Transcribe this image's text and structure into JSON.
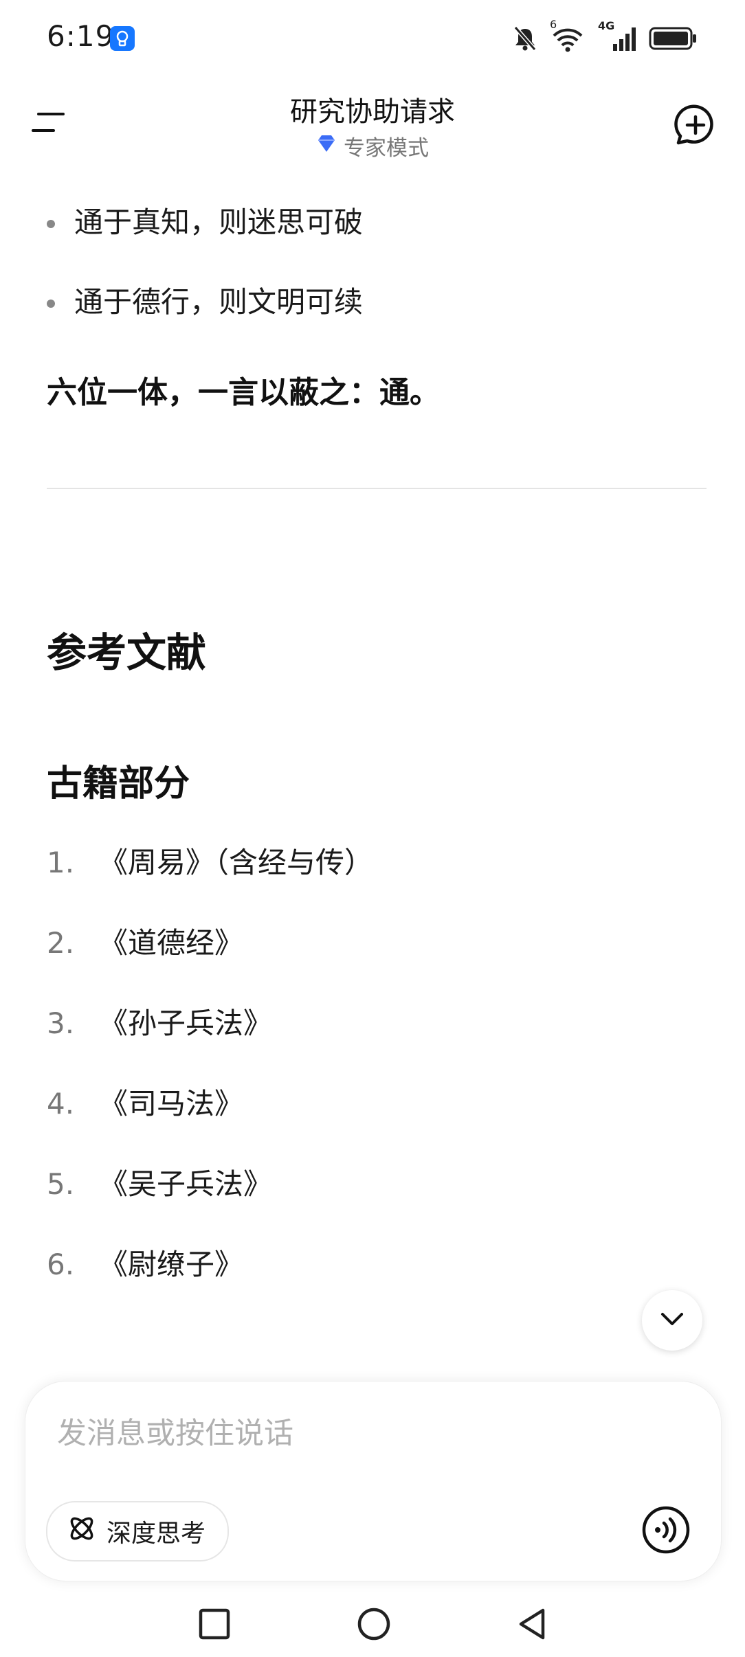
{
  "status_bar": {
    "time": "6:19",
    "app_icon": "bulb-icon",
    "network_label": "4G",
    "wifi_label": "6",
    "colors": {
      "app_icon": "#1677ff"
    }
  },
  "header": {
    "title": "研究协助请求",
    "mode_label": "专家模式",
    "mode_icon": "diamond-icon",
    "colors": {
      "mode_icon": "#3b6cf6"
    }
  },
  "content": {
    "bullets": [
      "通于真知，则迷思可破",
      "通于德行，则文明可续"
    ],
    "summary": "六位一体，一言以蔽之：通。",
    "section_title": "参考文献",
    "subsection_title": "古籍部分",
    "references": [
      {
        "num": "1.",
        "text": "《周易》（含经与传）"
      },
      {
        "num": "2.",
        "text": "《道德经》"
      },
      {
        "num": "3.",
        "text": "《孙子兵法》"
      },
      {
        "num": "4.",
        "text": "《司马法》"
      },
      {
        "num": "5.",
        "text": "《吴子兵法》"
      },
      {
        "num": "6.",
        "text": "《尉缭子》"
      }
    ]
  },
  "input": {
    "placeholder": "发消息或按住说话",
    "deep_think_label": "深度思考"
  },
  "nav": {
    "icons": [
      "square-icon",
      "circle-icon",
      "triangle-back-icon"
    ]
  }
}
